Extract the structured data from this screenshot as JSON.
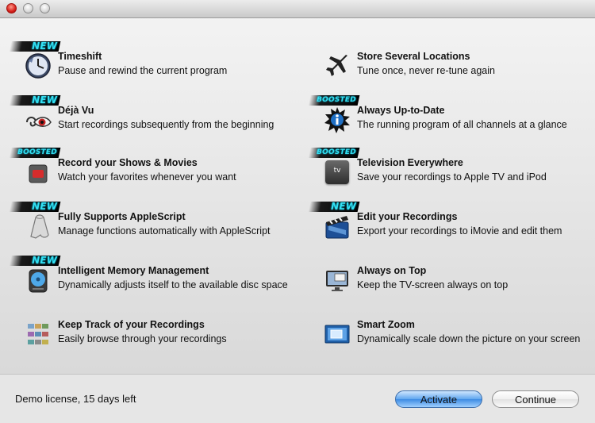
{
  "window": {
    "title": ""
  },
  "features_left": [
    {
      "badge": "NEW",
      "title": "Timeshift",
      "desc": "Pause and rewind the current program",
      "icon": "clock-icon"
    },
    {
      "badge": "NEW",
      "title": "Déjà Vu",
      "desc": "Start recordings subsequently from the beginning",
      "icon": "eye-loop-icon"
    },
    {
      "badge": "BOOSTED",
      "title": "Record your Shows & Movies",
      "desc": "Watch your favorites whenever you want",
      "icon": "record-icon"
    },
    {
      "badge": "NEW",
      "title": "Fully Supports AppleScript",
      "desc": "Manage functions automatically with AppleScript",
      "icon": "script-scroll-icon"
    },
    {
      "badge": "NEW",
      "title": "Intelligent Memory Management",
      "desc": "Dynamically adjusts itself to the available disc space",
      "icon": "hard-disk-icon"
    },
    {
      "badge": "",
      "title": "Keep Track of your Recordings",
      "desc": "Easily browse through your recordings",
      "icon": "thumbnail-grid-icon"
    }
  ],
  "features_right": [
    {
      "badge": "",
      "title": "Store Several Locations",
      "desc": "Tune once, never re-tune again",
      "icon": "airplane-icon"
    },
    {
      "badge": "BOOSTED",
      "title": "Always Up-to-Date",
      "desc": "The running program of all channels at a glance",
      "icon": "info-burst-icon"
    },
    {
      "badge": "BOOSTED",
      "title": "Television Everywhere",
      "desc": "Save your recordings to Apple TV and iPod",
      "icon": "apple-tv-icon",
      "icon_text": "tv"
    },
    {
      "badge": "NEW",
      "title": "Edit your Recordings",
      "desc": "Export your recordings to iMovie and edit them",
      "icon": "clapperboard-icon"
    },
    {
      "badge": "",
      "title": "Always on Top",
      "desc": "Keep the TV-screen always on top",
      "icon": "monitor-icon"
    },
    {
      "badge": "",
      "title": "Smart Zoom",
      "desc": "Dynamically scale down the picture on your screen",
      "icon": "zoom-screen-icon"
    }
  ],
  "footer": {
    "license_text": "Demo license, 15 days left",
    "activate_label": "Activate",
    "continue_label": "Continue"
  },
  "colors": {
    "badge_text": "#33e0f2",
    "activate_button": "#5fa6ef"
  }
}
